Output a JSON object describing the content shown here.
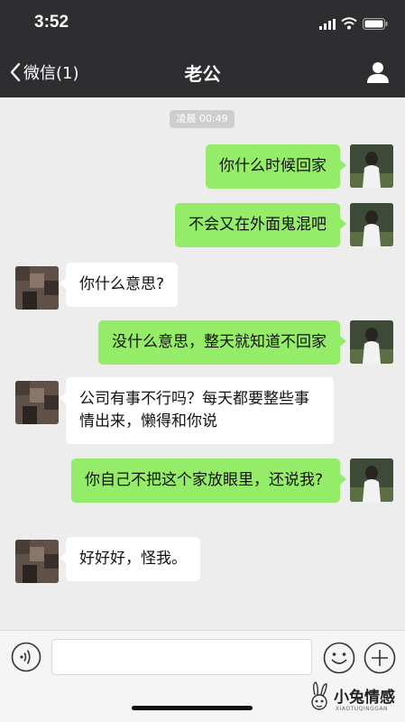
{
  "status": {
    "time": "3:52"
  },
  "nav": {
    "back_label": "微信(1)",
    "title": "老公"
  },
  "timestamp": "凌晨 00:49",
  "messages": [
    {
      "side": "out",
      "text": "你什么时候回家"
    },
    {
      "side": "out",
      "text": "不会又在外面鬼混吧"
    },
    {
      "side": "in",
      "text": "你什么意思?"
    },
    {
      "side": "out",
      "text": "没什么意思，整天就知道不回家"
    },
    {
      "side": "in",
      "text": "公司有事不行吗？每天都要整些事情出来，懒得和你说"
    },
    {
      "side": "out",
      "text": "你自己不把这个家放眼里，还说我?"
    },
    {
      "side": "in",
      "text": "好好好，怪我。"
    }
  ],
  "input": {
    "value": "",
    "placeholder": ""
  },
  "watermark": {
    "text": "小兔情感",
    "sub": "XIAOTUQINGGAN"
  },
  "colors": {
    "nav_bg": "#2e2e30",
    "chat_bg": "#ededed",
    "outgoing_bubble": "#95ec69",
    "incoming_bubble": "#ffffff"
  }
}
